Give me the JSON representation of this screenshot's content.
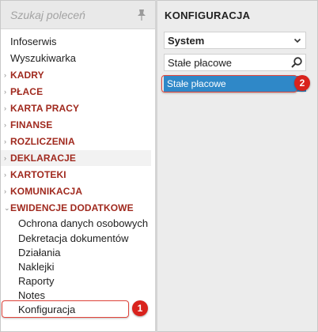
{
  "sidebar": {
    "search_placeholder": "Szukaj poleceń",
    "pin_icon": "pin-icon",
    "plain_items": [
      "Infoserwis",
      "Wyszukiwarka"
    ],
    "categories": [
      "KADRY",
      "PŁACE",
      "KARTA PRACY",
      "FINANSE",
      "ROZLICZENIA",
      "DEKLARACJE",
      "KARTOTEKI",
      "KOMUNIKACJA"
    ],
    "expanded_category": "EWIDENCJE DODATKOWE",
    "sub_items": [
      "Ochrona danych osobowych",
      "Dekretacja dokumentów",
      "Działania",
      "Naklejki",
      "Raporty",
      "Notes",
      "Konfiguracja"
    ]
  },
  "panel": {
    "title": "KONFIGURACJA",
    "select_value": "System",
    "search_value": "Stałe płacowe",
    "result_item": "Stałe płacowe"
  },
  "annotations": {
    "badge_1": "1",
    "badge_2": "2"
  },
  "colors": {
    "category_text": "#a0291e",
    "selected_bg": "#2f88c8",
    "annotation_red": "#d9231d"
  }
}
